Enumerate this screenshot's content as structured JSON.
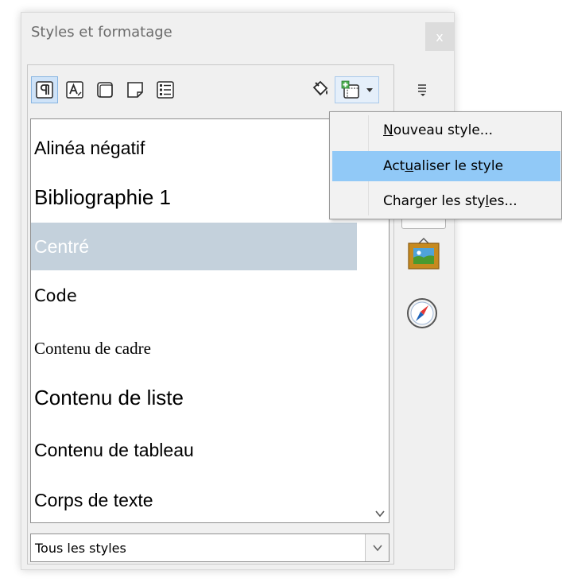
{
  "dialog": {
    "title": "Styles et formatage",
    "close_label": "x"
  },
  "toolbar": {
    "buttons": [
      {
        "icon": "paragraph-styles-icon",
        "selected": true
      },
      {
        "icon": "character-styles-icon",
        "selected": false
      },
      {
        "icon": "frame-styles-icon",
        "selected": false
      },
      {
        "icon": "page-styles-icon",
        "selected": false
      },
      {
        "icon": "list-styles-icon",
        "selected": false
      }
    ],
    "fill_format_icon": "paint-bucket-icon",
    "new_style_icon": "new-style-from-selection-icon"
  },
  "styles": [
    {
      "label": "Alinéa négatif",
      "font": "sans",
      "size": 23
    },
    {
      "label": "Bibliographie 1",
      "font": "sans",
      "size": 26
    },
    {
      "label": "Centré",
      "font": "sans",
      "size": 23,
      "selected": true
    },
    {
      "label": "Code",
      "font": "sans",
      "size": 22
    },
    {
      "label": "Contenu de cadre",
      "font": "serif",
      "size": 20
    },
    {
      "label": "Contenu de liste",
      "font": "sans",
      "size": 26
    },
    {
      "label": "Contenu de tableau",
      "font": "sans",
      "size": 23
    },
    {
      "label": "Corps de texte",
      "font": "sans",
      "size": 23
    }
  ],
  "filter": {
    "value": "Tous les styles"
  },
  "menu": {
    "items": [
      {
        "pre": "",
        "acc": "N",
        "post": "ouveau style...",
        "highlighted": false
      },
      {
        "pre": "Act",
        "acc": "u",
        "post": "aliser le style",
        "highlighted": true
      },
      {
        "pre": "Charger les sty",
        "acc": "l",
        "post": "es...",
        "highlighted": false
      }
    ]
  },
  "deck": {
    "icons": [
      "deck-menu-icon",
      "gallery-icon",
      "navigator-icon"
    ]
  }
}
